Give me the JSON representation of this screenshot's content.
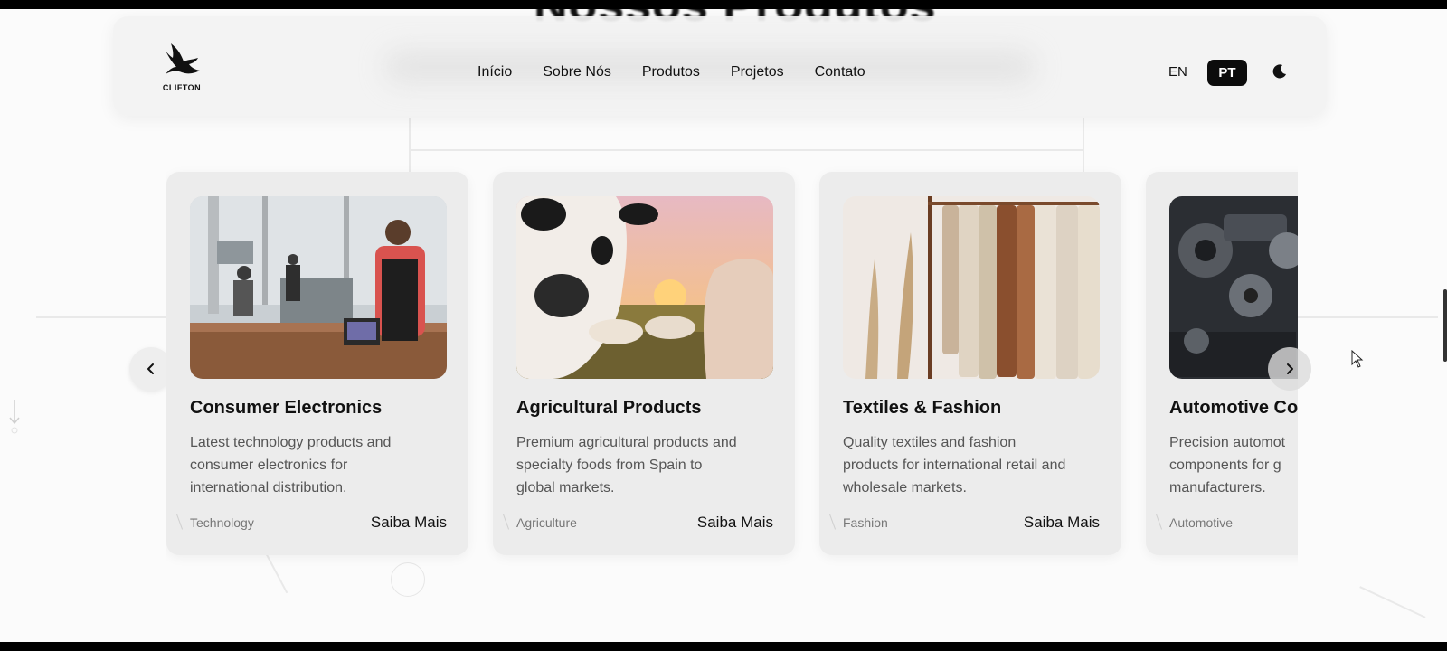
{
  "hero": {
    "title": "Nossos Produtos"
  },
  "brand": {
    "logo_text": "CLIFTON",
    "logo_icon": "eagle-icon"
  },
  "nav": {
    "links": [
      "Início",
      "Sobre Nós",
      "Produtos",
      "Projetos",
      "Contato"
    ]
  },
  "lang": {
    "en": "EN",
    "pt": "PT",
    "active": "PT"
  },
  "theme": {
    "icon": "moon-icon"
  },
  "carousel": {
    "prev_icon": "chevron-left-icon",
    "next_icon": "chevron-right-icon",
    "cards": [
      {
        "title": "Consumer Electronics",
        "description": "Latest technology products and\nconsumer electronics for\ninternational distribution.",
        "tag": "Technology",
        "link": "Saiba Mais",
        "image": "coffee-shop-pos-photo"
      },
      {
        "title": "Agricultural Products",
        "description": "Premium agricultural products and\nspecialty foods from Spain to\nglobal markets.",
        "tag": "Agriculture",
        "link": "Saiba Mais",
        "image": "cows-sunset-photo"
      },
      {
        "title": "Textiles & Fashion",
        "description": "Quality textiles and fashion\nproducts for international retail and\nwholesale markets.",
        "tag": "Fashion",
        "link": "Saiba Mais",
        "image": "clothing-rack-photo"
      },
      {
        "title": "Automotive Co",
        "description": "Precision automot\ncomponents for g\nmanufacturers.",
        "tag": "Automotive",
        "link": "",
        "image": "engine-parts-photo"
      }
    ]
  },
  "colors": {
    "accent_dark": "#0c0c0c",
    "card_bg": "#ececec",
    "page_bg": "#fbfbfb"
  }
}
